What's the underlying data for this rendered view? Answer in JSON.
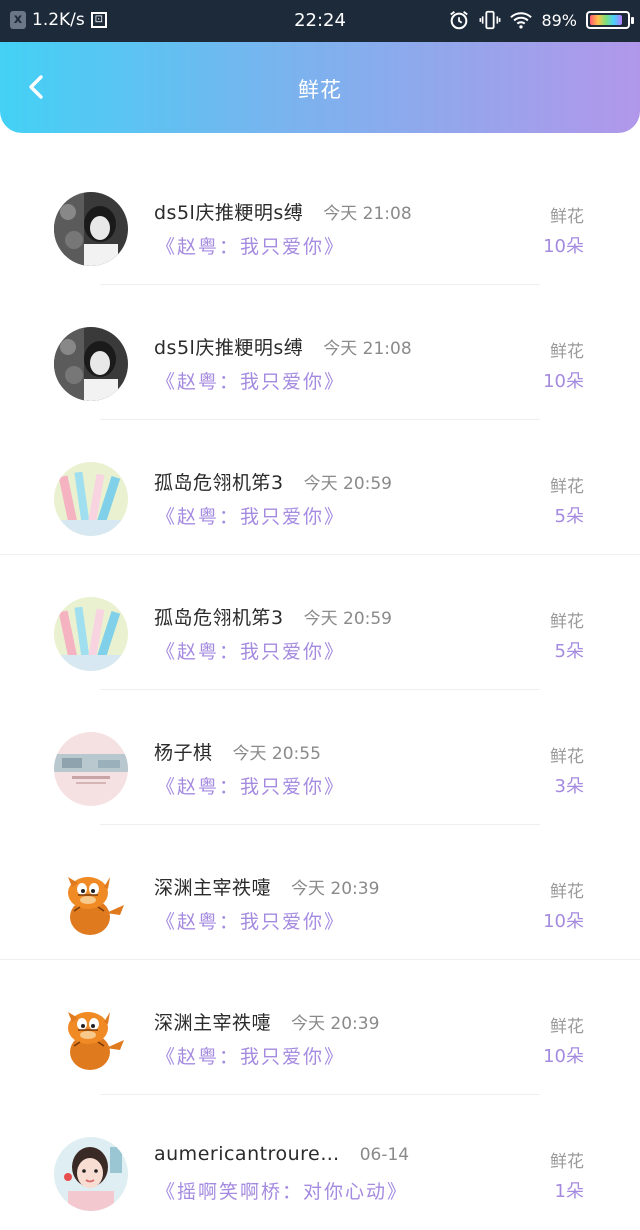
{
  "status_bar": {
    "net_speed": "1.2K/s",
    "time": "22:24",
    "battery": "89%",
    "battery_level": 0.89
  },
  "header": {
    "title": "鲜花"
  },
  "rows": [
    {
      "name": "ds5l庆推粳明s缚",
      "time": "今天 21:08",
      "song": "《赵粤：我只爱你》",
      "flower_label": "鲜花",
      "count": "10朵"
    },
    {
      "name": "ds5l庆推粳明s缚",
      "time": "今天 21:08",
      "song": "《赵粤：我只爱你》",
      "flower_label": "鲜花",
      "count": "10朵"
    },
    {
      "name": "孤岛危翎机笫3",
      "time": "今天 20:59",
      "song": "《赵粤：我只爱你》",
      "flower_label": "鲜花",
      "count": "5朵"
    },
    {
      "name": "孤岛危翎机笫3",
      "time": "今天 20:59",
      "song": "《赵粤：我只爱你》",
      "flower_label": "鲜花",
      "count": "5朵"
    },
    {
      "name": "杨子棋",
      "time": "今天 20:55",
      "song": "《赵粤：我只爱你》",
      "flower_label": "鲜花",
      "count": "3朵"
    },
    {
      "name": "深渊主宰祑嚏",
      "time": "今天 20:39",
      "song": "《赵粤：我只爱你》",
      "flower_label": "鲜花",
      "count": "10朵"
    },
    {
      "name": "深渊主宰祑嚏",
      "time": "今天 20:39",
      "song": "《赵粤：我只爱你》",
      "flower_label": "鲜花",
      "count": "10朵"
    },
    {
      "name": "aumericantroure…",
      "time": "06-14",
      "song": "《摇啊笑啊桥：对你心动》",
      "flower_label": "鲜花",
      "count": "1朵"
    }
  ]
}
